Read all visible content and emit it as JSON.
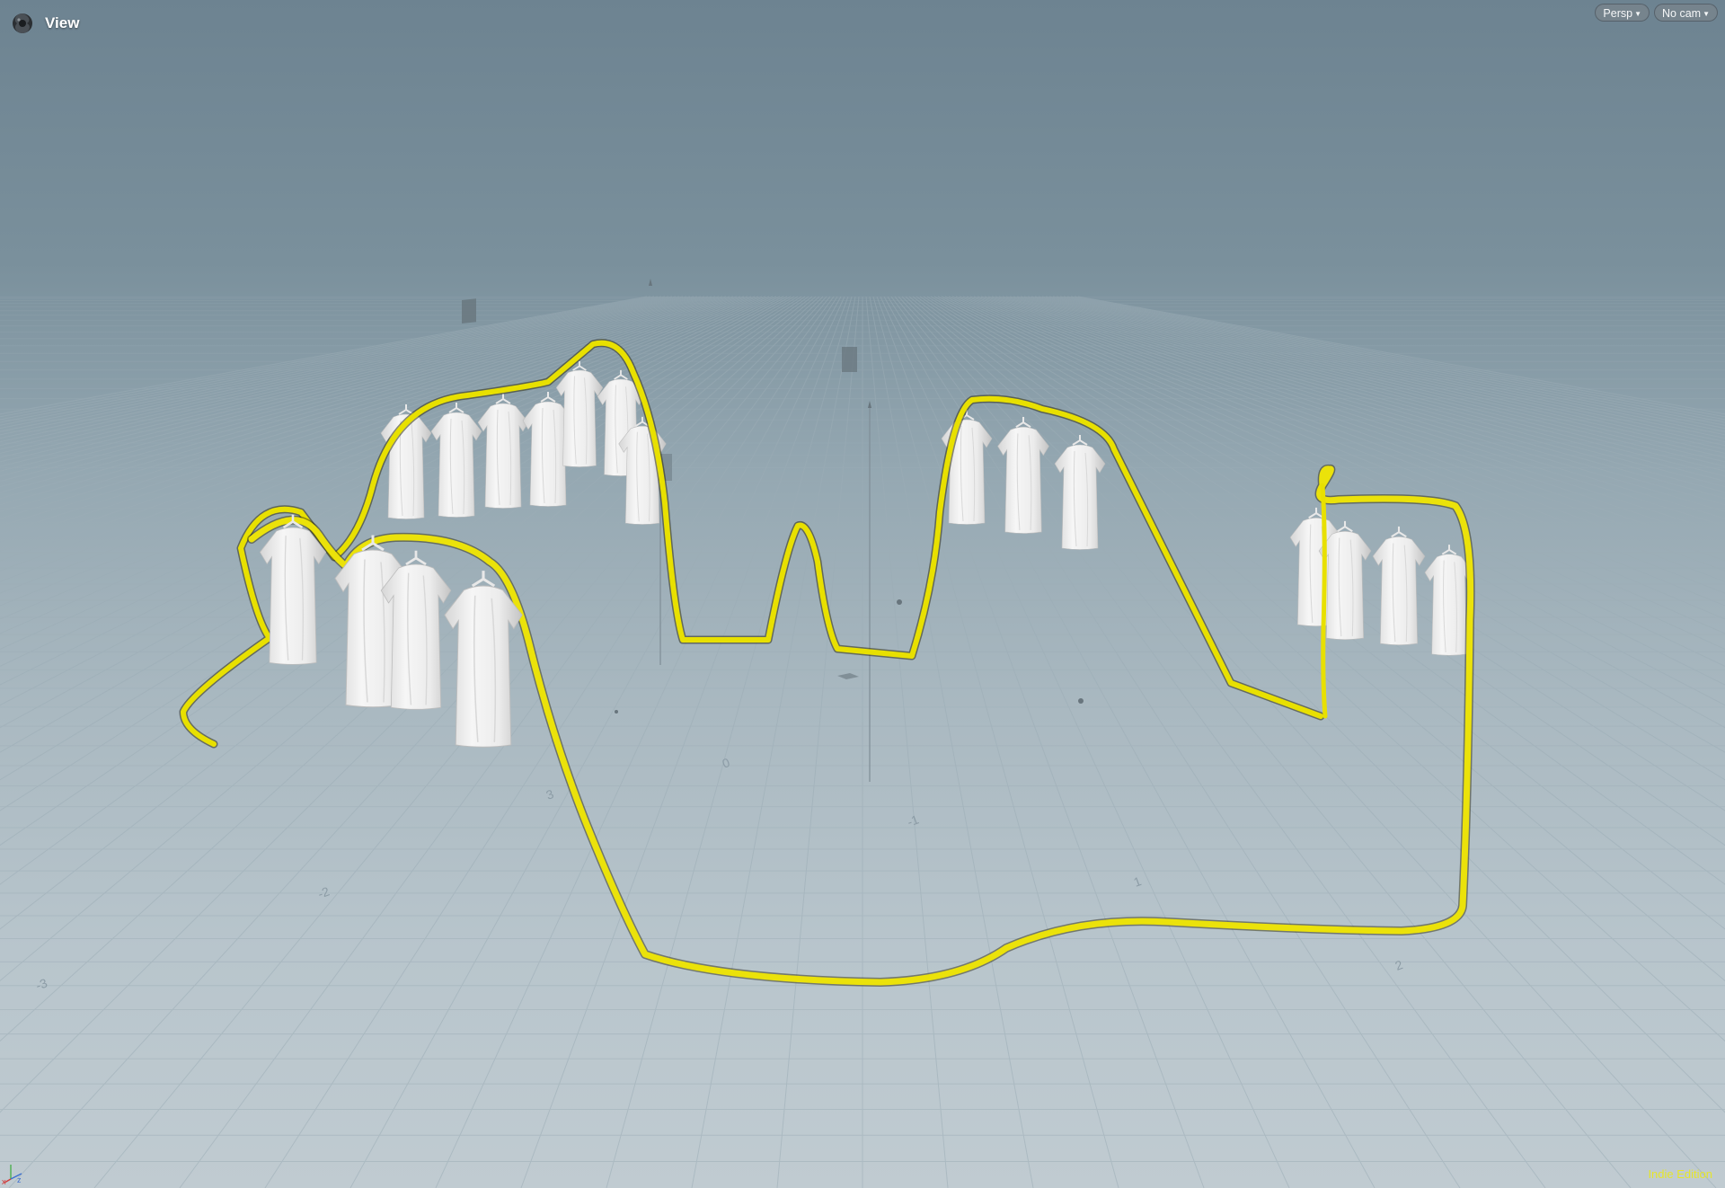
{
  "header": {
    "title": "View",
    "icon": "houdini-icon"
  },
  "viewport_controls": {
    "projection": "Persp",
    "camera": "No cam"
  },
  "axis_labels": {
    "x": "x",
    "z": "z"
  },
  "grid_labels": [
    "-3",
    "-2",
    "-1",
    "0",
    "1",
    "2",
    "3"
  ],
  "edition_label": "Indie Edition",
  "colors": {
    "curve": "#e8e000",
    "curve_shadow": "#2a2a10",
    "shirt": "#f1f1f1",
    "shirt_shade": "#c9c9c9",
    "grid": "#8fa0aa"
  },
  "scene": {
    "description_visible": false
  }
}
